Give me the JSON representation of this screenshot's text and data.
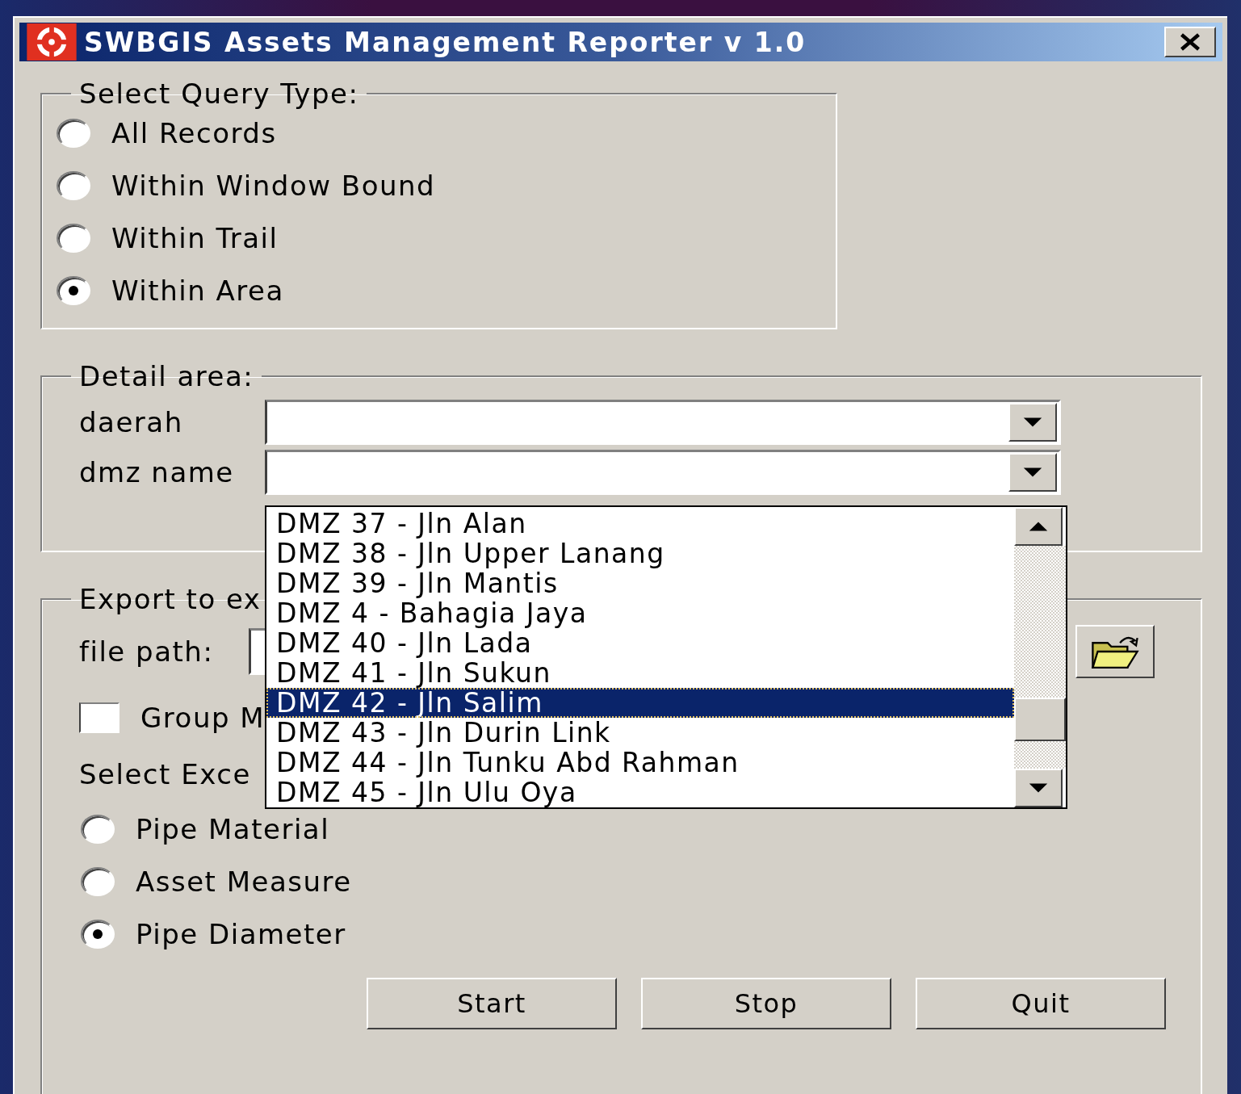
{
  "window": {
    "title": "SWBGIS Assets Management Reporter v 1.0"
  },
  "query_type": {
    "label": "Select Query Type:",
    "options": [
      {
        "label": "All Records",
        "selected": false
      },
      {
        "label": "Within Window Bound",
        "selected": false
      },
      {
        "label": "Within Trail",
        "selected": false
      },
      {
        "label": "Within Area",
        "selected": true
      }
    ]
  },
  "detail_area": {
    "label": "Detail area:",
    "fields": [
      {
        "label": "daerah"
      },
      {
        "label": "dmz name"
      }
    ]
  },
  "dmz_list": {
    "items": [
      {
        "label": "DMZ 37 - Jln Alan",
        "selected": false
      },
      {
        "label": "DMZ 38 - Jln Upper Lanang",
        "selected": false
      },
      {
        "label": "DMZ 39 - Jln Mantis",
        "selected": false
      },
      {
        "label": "DMZ 4 - Bahagia Jaya",
        "selected": false
      },
      {
        "label": "DMZ 40 - Jln Lada",
        "selected": false
      },
      {
        "label": "DMZ 41 - Jln Sukun",
        "selected": false
      },
      {
        "label": "DMZ 42 - Jln Salim",
        "selected": true
      },
      {
        "label": "DMZ 43 - Jln Durin Link",
        "selected": false
      },
      {
        "label": "DMZ 44 - Jln Tunku Abd Rahman",
        "selected": false
      },
      {
        "label": "DMZ 45 - Jln Ulu Oya",
        "selected": false
      }
    ]
  },
  "export": {
    "label": "Export to ex",
    "file_path_label": "file path:",
    "group_checkbox": {
      "label": "Group M",
      "checked": false
    },
    "select_label": "Select Exce",
    "options": [
      {
        "label": "Pipe Material",
        "selected": false
      },
      {
        "label": "Asset Measure",
        "selected": false
      },
      {
        "label": "Pipe Diameter",
        "selected": true
      }
    ]
  },
  "buttons": [
    "Start",
    "Stop",
    "Quit"
  ]
}
